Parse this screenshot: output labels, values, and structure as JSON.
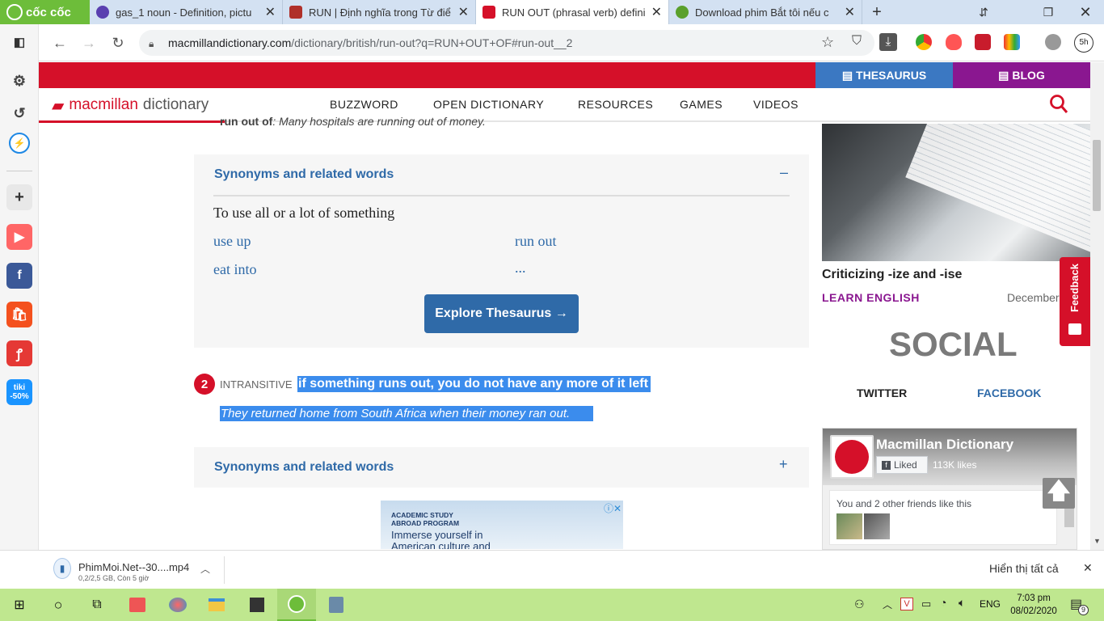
{
  "browser": {
    "brand": "cốc cốc",
    "tabs": [
      {
        "title": "gas_1 noun - Definition, pictu",
        "color": "#5a3fb0"
      },
      {
        "title": "RUN | Định nghĩa trong Từ điể",
        "color": "#b0302a"
      },
      {
        "title": "RUN OUT (phrasal verb) defini",
        "color": "#d51029"
      },
      {
        "title": "Download phim Bắt tôi nếu c",
        "color": "#5aa02c"
      }
    ],
    "url_domain": "macmillandictionary.com",
    "url_path": "/dictionary/british/run-out?q=RUN+OUT+OF#run-out__2",
    "profile_badge": "5h"
  },
  "site": {
    "thesaurus": "THESAURUS",
    "blog": "BLOG",
    "logo_brand": "macmillan",
    "logo_dict": "dictionary",
    "nav": [
      "BUZZWORD",
      "OPEN DICTIONARY",
      "RESOURCES",
      "GAMES",
      "VIDEOS"
    ]
  },
  "entry": {
    "snippet_lead": "run out of",
    "snippet": ": Many hospitals are running out of money.",
    "syn1": {
      "title": "Synonyms and related words",
      "toggle": "–",
      "heading": "To use all or a lot of something",
      "words": [
        "use up",
        "run out",
        "eat into",
        "..."
      ],
      "button": "Explore Thesaurus →"
    },
    "sense2": {
      "number": "2",
      "grammar": "INTRANSITIVE",
      "definition": "if something runs out, you do not have any more of it left",
      "example": "They returned home from South Africa when their money ran out."
    },
    "syn2": {
      "title": "Synonyms and related words",
      "toggle": "+"
    },
    "ad": {
      "line1": "ACADEMIC STUDY",
      "line2": "ABROAD PROGRAM",
      "line3": "Immerse yourself in",
      "line4": "American culture and"
    }
  },
  "sidebar_right": {
    "article_title": "Criticizing -ize and -ise",
    "category": "LEARN ENGLISH",
    "date": "December",
    "social": "SOCIAL",
    "twitter": "TWITTER",
    "facebook": "FACEBOOK",
    "fb_page": "Macmillan Dictionary",
    "fb_liked": "Liked",
    "fb_likes": "113K likes",
    "fb_friends": "You and 2 other friends like this",
    "feedback": "Feedback"
  },
  "download": {
    "filename": "PhimMoi.Net--30....mp4",
    "status": "0,2/2,5 GB, Còn 5 giờ",
    "show_all": "Hiển thị tất cả"
  },
  "taskbar": {
    "lang": "ENG",
    "time": "7:03 pm",
    "date": "08/02/2020",
    "notif": "9"
  }
}
